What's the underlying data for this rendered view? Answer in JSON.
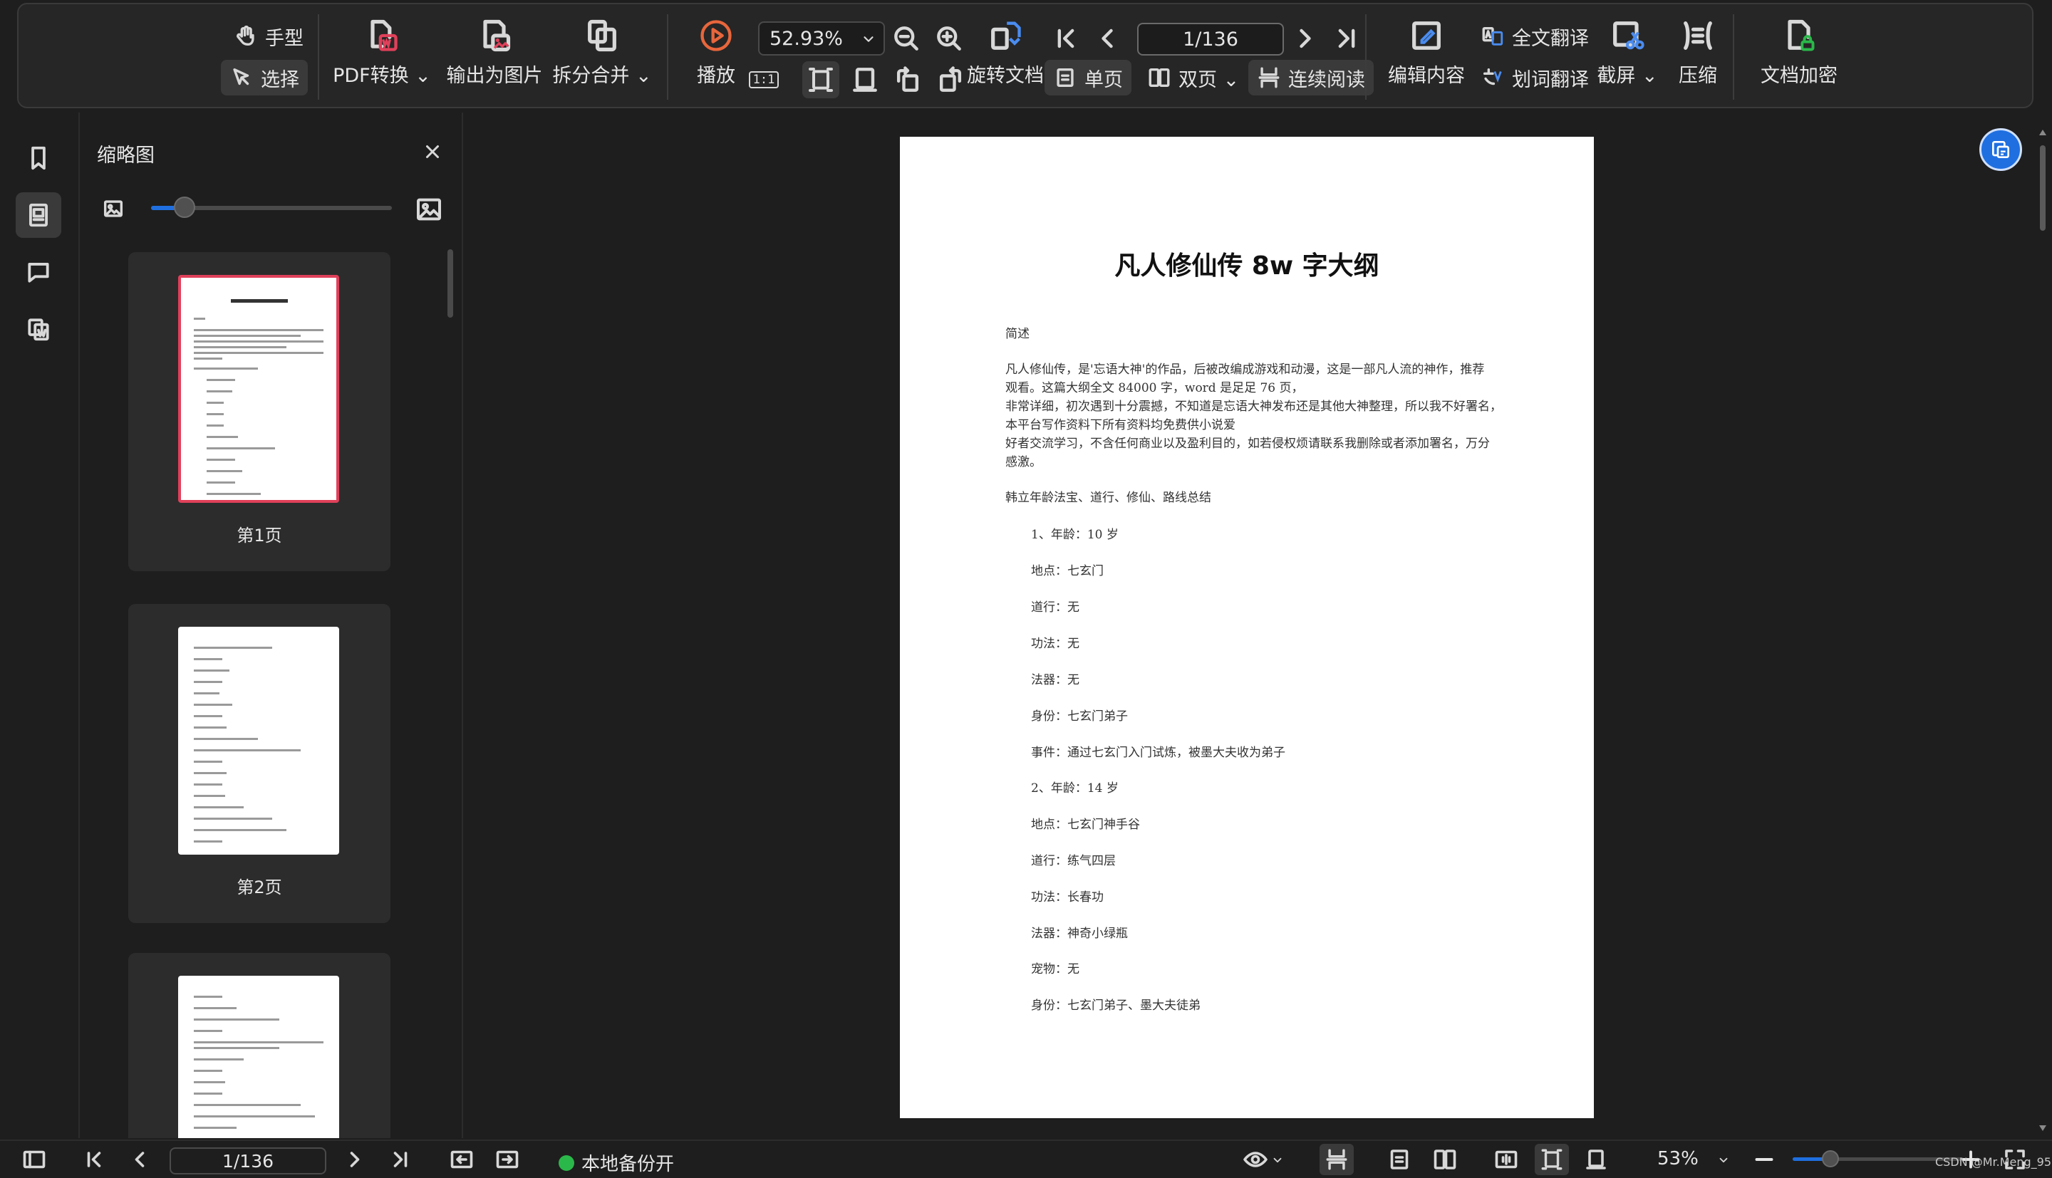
{
  "toolbar": {
    "hand": "手型",
    "select": "选择",
    "pdf_convert": "PDF转换",
    "export_image": "输出为图片",
    "split_merge": "拆分合并",
    "play": "播放",
    "zoom": "52.93%",
    "rotate_doc": "旋转文档",
    "page_indicator": "1/136",
    "single_page": "单页",
    "double_page": "双页",
    "continuous": "连续阅读",
    "edit_content": "编辑内容",
    "full_translate": "全文翻译",
    "word_translate": "划词翻译",
    "screenshot": "截屏",
    "compress": "压缩",
    "encrypt": "文档加密",
    "actual_size_label": "1:1"
  },
  "thumbnail_panel": {
    "title": "缩略图",
    "slider_level": 0.14,
    "pages": [
      {
        "label": "第1页",
        "selected": true
      },
      {
        "label": "第2页",
        "selected": false
      },
      {
        "label": "",
        "selected": false
      }
    ]
  },
  "document": {
    "title": "凡人修仙传 8w 字大纲",
    "lines": [
      {
        "text": "简述",
        "indent": false
      },
      {
        "text": "凡人修仙传，是'忘语大神'的作品，后被改编成游戏和动漫，这是一部凡人流的神作，推荐",
        "indent": false
      },
      {
        "text": "观看。这篇大纲全文 84000 字，word 是足足 76 页，",
        "indent": false
      },
      {
        "text": "非常详细，初次遇到十分震撼，不知道是忘语大神发布还是其他大神整理，所以我不好署名，",
        "indent": false
      },
      {
        "text": "本平台写作资料下所有资料均免费供小说爱",
        "indent": false
      },
      {
        "text": "好者交流学习，不含任何商业以及盈利目的，如若侵权烦请联系我删除或者添加署名，万分",
        "indent": false
      },
      {
        "text": "感激。",
        "indent": false
      },
      {
        "text": "韩立年龄法宝、道行、修仙、路线总结",
        "indent": false
      },
      {
        "text": "1、年龄：10 岁",
        "indent": true
      },
      {
        "text": "地点：七玄门",
        "indent": true
      },
      {
        "text": "道行：无",
        "indent": true
      },
      {
        "text": "功法：无",
        "indent": true
      },
      {
        "text": "法器：无",
        "indent": true
      },
      {
        "text": "身份：七玄门弟子",
        "indent": true
      },
      {
        "text": "事件：通过七玄门入门试炼，被墨大夫收为弟子",
        "indent": true
      },
      {
        "text": "2、年龄：14 岁",
        "indent": true
      },
      {
        "text": "地点：七玄门神手谷",
        "indent": true
      },
      {
        "text": "道行：练气四层",
        "indent": true
      },
      {
        "text": "功法：长春功",
        "indent": true
      },
      {
        "text": "法器：神奇小绿瓶",
        "indent": true
      },
      {
        "text": "宠物：无",
        "indent": true
      },
      {
        "text": "身份：七玄门弟子、墨大夫徒弟",
        "indent": true
      }
    ]
  },
  "statusbar": {
    "page_indicator": "1/136",
    "backup": "本地备份开",
    "backup_status_color": "#2bb84a",
    "zoom": "53%",
    "zoom_level": 0.22,
    "watermark": "CSDN @Mr.Meng_95"
  },
  "colors": {
    "accent": "#1f6fe0",
    "selected_thumb_border": "#e0405a"
  }
}
